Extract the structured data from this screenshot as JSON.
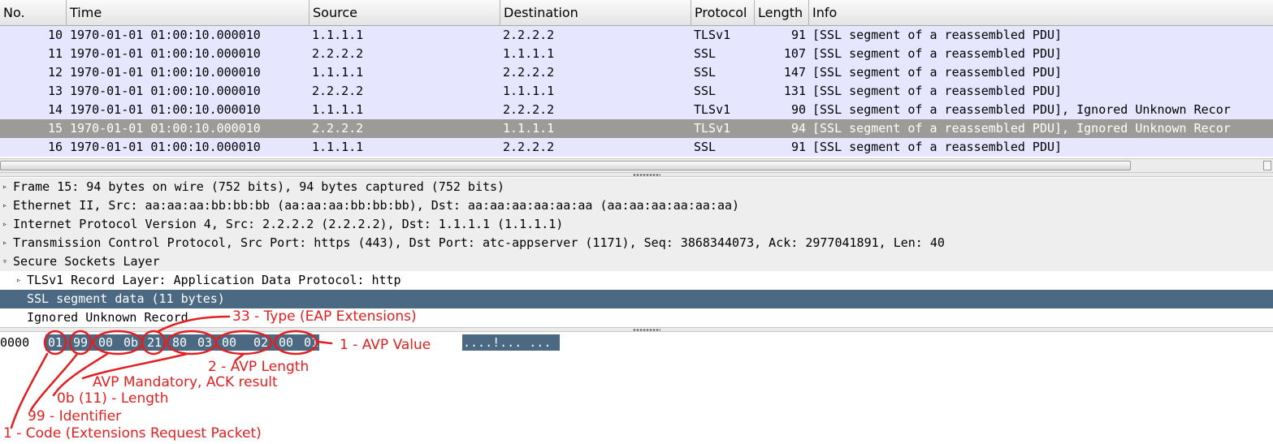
{
  "columns": {
    "no": "No.",
    "time": "Time",
    "source": "Source",
    "destination": "Destination",
    "protocol": "Protocol",
    "length": "Length",
    "info": "Info"
  },
  "packets": [
    {
      "no": "10",
      "time": "1970-01-01 01:00:10.000010",
      "source": "1.1.1.1",
      "destination": "2.2.2.2",
      "protocol": "TLSv1",
      "length": "91",
      "info": "[SSL segment of a reassembled PDU]",
      "selected": false
    },
    {
      "no": "11",
      "time": "1970-01-01 01:00:10.000010",
      "source": "2.2.2.2",
      "destination": "1.1.1.1",
      "protocol": "SSL",
      "length": "107",
      "info": "[SSL segment of a reassembled PDU]",
      "selected": false
    },
    {
      "no": "12",
      "time": "1970-01-01 01:00:10.000010",
      "source": "1.1.1.1",
      "destination": "2.2.2.2",
      "protocol": "SSL",
      "length": "147",
      "info": "[SSL segment of a reassembled PDU]",
      "selected": false
    },
    {
      "no": "13",
      "time": "1970-01-01 01:00:10.000010",
      "source": "2.2.2.2",
      "destination": "1.1.1.1",
      "protocol": "SSL",
      "length": "131",
      "info": "[SSL segment of a reassembled PDU]",
      "selected": false
    },
    {
      "no": "14",
      "time": "1970-01-01 01:00:10.000010",
      "source": "1.1.1.1",
      "destination": "2.2.2.2",
      "protocol": "TLSv1",
      "length": "90",
      "info": "[SSL segment of a reassembled PDU], Ignored Unknown Recor",
      "selected": false
    },
    {
      "no": "15",
      "time": "1970-01-01 01:00:10.000010",
      "source": "2.2.2.2",
      "destination": "1.1.1.1",
      "protocol": "TLSv1",
      "length": "94",
      "info": "[SSL segment of a reassembled PDU], Ignored Unknown Recor",
      "selected": true
    },
    {
      "no": "16",
      "time": "1970-01-01 01:00:10.000010",
      "source": "1.1.1.1",
      "destination": "2.2.2.2",
      "protocol": "SSL",
      "length": "91",
      "info": "[SSL segment of a reassembled PDU]",
      "selected": false
    }
  ],
  "details": [
    {
      "text": "Frame 15: 94 bytes on wire (752 bits), 94 bytes captured (752 bits)",
      "expander": "collapsed",
      "indent": 0,
      "style": "grey"
    },
    {
      "text": "Ethernet II, Src: aa:aa:aa:bb:bb:bb (aa:aa:aa:bb:bb:bb), Dst: aa:aa:aa:aa:aa:aa (aa:aa:aa:aa:aa:aa)",
      "expander": "collapsed",
      "indent": 0,
      "style": "grey"
    },
    {
      "text": "Internet Protocol Version 4, Src: 2.2.2.2 (2.2.2.2), Dst: 1.1.1.1 (1.1.1.1)",
      "expander": "collapsed",
      "indent": 0,
      "style": "grey"
    },
    {
      "text": "Transmission Control Protocol, Src Port: https (443), Dst Port: atc-appserver (1171), Seq: 3868344073, Ack: 2977041891, Len: 40",
      "expander": "collapsed",
      "indent": 0,
      "style": "grey"
    },
    {
      "text": "Secure Sockets Layer",
      "expander": "expanded",
      "indent": 0,
      "style": "grey"
    },
    {
      "text": "TLSv1 Record Layer: Application Data Protocol: http",
      "expander": "collapsed",
      "indent": 1,
      "style": "white"
    },
    {
      "text": "SSL segment data (11 bytes)",
      "expander": "none",
      "indent": 1,
      "style": "selected"
    },
    {
      "text": "Ignored Unknown Record",
      "expander": "none",
      "indent": 1,
      "style": "white"
    }
  ],
  "bytes": {
    "offset": "0000",
    "hex": [
      "01",
      "99",
      "00",
      "0b",
      "21",
      "80",
      "03",
      "00",
      "02",
      "00",
      "01"
    ],
    "ascii": "....!... ..."
  },
  "annotations": {
    "type": "33 - Type (EAP Extensions)",
    "avp_value": "1 - AVP Value",
    "avp_length": "2 - AVP Length",
    "avp_mandatory": "AVP Mandatory, ACK result",
    "length": "0b (11) - Length",
    "identifier": "99 - Identifier",
    "code": "1 - Code (Extensions Request Packet)"
  },
  "colors": {
    "row_bg": "#e7e6ff",
    "row_selected_bg": "#9c9b97",
    "detail_selected_bg": "#4b6983",
    "annotation": "#e02020"
  }
}
